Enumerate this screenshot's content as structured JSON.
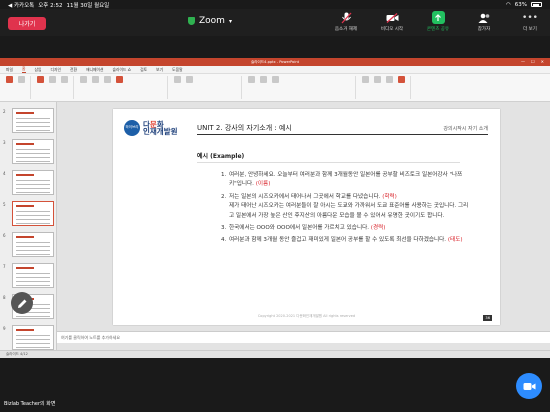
{
  "statusbar": {
    "carrier": "◀ 카카오톡",
    "time": "오후 2:52",
    "date": "11월 30일 월요일",
    "battery": "63%"
  },
  "zoom": {
    "leave_label": "나가기",
    "app_title": "Zoom",
    "actions": [
      {
        "label": "음소거 해제",
        "icon": "mic-off-icon"
      },
      {
        "label": "비디오 시작",
        "icon": "video-off-icon"
      },
      {
        "label": "콘텐츠 공유",
        "icon": "share-screen-icon"
      },
      {
        "label": "참가자",
        "icon": "participants-icon"
      },
      {
        "label": "더 보기",
        "icon": "more-icon"
      }
    ],
    "sharer_label": "Bizlab Teacher의 화면"
  },
  "ppt": {
    "window_title": "슬라이드4.pptx - PowerPoint",
    "tabs": [
      "파일",
      "홈",
      "삽입",
      "디자인",
      "전환",
      "애니메이션",
      "슬라이드 쇼",
      "검토",
      "보기",
      "도움말"
    ],
    "active_tab": 1,
    "notes_placeholder": "여기를 클릭하여 노트를 추가하세요",
    "status_left": "슬라이드 4/12",
    "thumb_numbers": [
      "2",
      "3",
      "4",
      "5",
      "6",
      "7",
      "8",
      "9"
    ],
    "selected_thumb": 3
  },
  "slide": {
    "logo_badge": "하이브리",
    "logo_line1_a": "다",
    "logo_line1_b": "문",
    "logo_line1_c": "화",
    "logo_line2": "인재개발원",
    "title": "UNIT 2. 강사의 자기소개 : 예시",
    "subtitle": "강의시작시 자기 소개",
    "example_heading": "예시 (Example)",
    "items": [
      {
        "n": "1.",
        "text": "여러분, 안녕하세요.  오늘부터 여러분과 함께 3개월동안 일본어를 공부할 비즈토크 일본어강사 \"나쯔키\"입니다.",
        "tag": "(이름)"
      },
      {
        "n": "2.",
        "text": "저는 일본의 시즈오카에서 태어나서 그곳에서 학교를 다녔습니다.",
        "tag": "(학력)",
        "rest": "제가 태어난 시즈오카는 여러분들이 잘 아시는 도쿄와 가까워서 도쿄 표준어를 사용하는 곳입니다.  그리고 일본에서 가장 높은 산인 후지산의 아름다운 모습을 볼 수 있어서 유명한 곳이기도 합니다."
      },
      {
        "n": "3.",
        "text": "한국에서는 OOO와 OOO에서 일본어를 가르치고 있습니다.",
        "tag": "(경력)"
      },
      {
        "n": "4.",
        "text": "여러분과 함께 3개월 동안 즐겁고 재미있게 일본어 공부를 할 수 있도록  최선을 다하겠습니다.",
        "tag": "(태도)"
      }
    ],
    "footer": "Copyright 2020-2021 다문화인재개발원 All rights reserved",
    "page_no": "36"
  }
}
